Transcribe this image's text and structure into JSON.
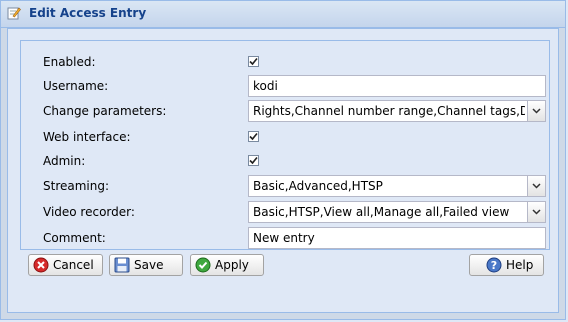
{
  "window": {
    "title": "Edit Access Entry"
  },
  "form": {
    "enabled": {
      "label": "Enabled:",
      "checked": true
    },
    "username": {
      "label": "Username:",
      "value": "kodi"
    },
    "change_parameters": {
      "label": "Change parameters:",
      "value": "Rights,Channel number range,Channel tags,DVR c"
    },
    "web_interface": {
      "label": "Web interface:",
      "checked": true
    },
    "admin": {
      "label": "Admin:",
      "checked": true
    },
    "streaming": {
      "label": "Streaming:",
      "value": "Basic,Advanced,HTSP"
    },
    "video_recorder": {
      "label": "Video recorder:",
      "value": "Basic,HTSP,View all,Manage all,Failed view"
    },
    "comment": {
      "label": "Comment:",
      "value": "New entry"
    }
  },
  "buttons": {
    "cancel": "Cancel",
    "save": "Save",
    "apply": "Apply",
    "help": "Help"
  },
  "icons": {
    "title": "edit-pencil-icon",
    "cancel": "cancel-icon",
    "save": "save-icon",
    "apply": "apply-check-icon",
    "help": "help-icon"
  },
  "colors": {
    "title_text": "#15428b",
    "window_bg": "#dfe8f6",
    "border": "#99bbe8"
  }
}
